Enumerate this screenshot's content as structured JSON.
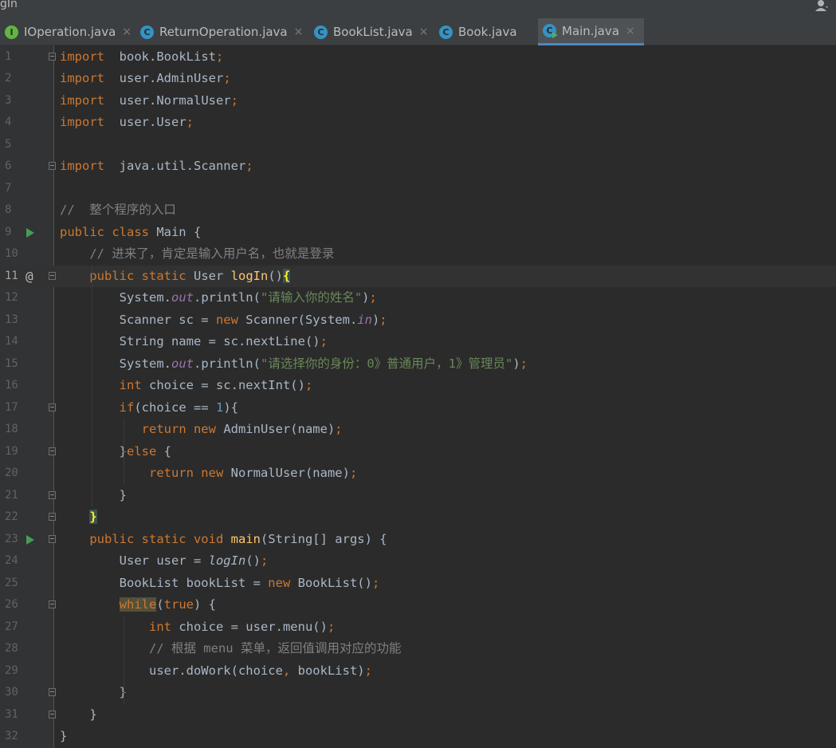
{
  "window": {
    "title": "gIn"
  },
  "tabs": [
    {
      "label": "IOperation.java",
      "icon": "I",
      "icon_type": "iface",
      "close": "×",
      "active": false
    },
    {
      "label": "ReturnOperation.java",
      "icon": "C",
      "icon_type": "cls",
      "close": "×",
      "active": false
    },
    {
      "label": "BookList.java",
      "icon": "C",
      "icon_type": "cls",
      "close": "×",
      "active": false
    },
    {
      "label": "Book.java",
      "icon": "C",
      "icon_type": "cls",
      "close": "",
      "active": false
    },
    {
      "label": "Main.java",
      "icon": "C",
      "icon_type": "main",
      "close": "×",
      "active": true
    }
  ],
  "editor": {
    "current_line": 11,
    "lines": [
      {
        "n": "1",
        "fold": true,
        "tokens": [
          [
            "kw",
            "import"
          ],
          [
            "",
            "  book.BookList"
          ],
          [
            "kw",
            ";"
          ]
        ]
      },
      {
        "n": "2",
        "tokens": [
          [
            "kw",
            "import"
          ],
          [
            "",
            "  user.AdminUser"
          ],
          [
            "kw",
            ";"
          ]
        ]
      },
      {
        "n": "3",
        "tokens": [
          [
            "kw",
            "import"
          ],
          [
            "",
            "  user.NormalUser"
          ],
          [
            "kw",
            ";"
          ]
        ]
      },
      {
        "n": "4",
        "tokens": [
          [
            "kw",
            "import"
          ],
          [
            "",
            "  user.User"
          ],
          [
            "kw",
            ";"
          ]
        ]
      },
      {
        "n": "5",
        "tokens": []
      },
      {
        "n": "6",
        "fold": true,
        "tokens": [
          [
            "kw",
            "import"
          ],
          [
            "",
            "  java.util.Scanner"
          ],
          [
            "kw",
            ";"
          ]
        ]
      },
      {
        "n": "7",
        "tokens": []
      },
      {
        "n": "8",
        "tokens": [
          [
            "cm",
            "//  整个程序的入口"
          ]
        ]
      },
      {
        "n": "9",
        "run": true,
        "tokens": [
          [
            "kw",
            "public class"
          ],
          [
            "",
            " Main {"
          ]
        ]
      },
      {
        "n": "10",
        "tokens": [
          [
            "",
            "    "
          ],
          [
            "cm",
            "// 进来了，肯定是输入用户名，也就是登录"
          ]
        ]
      },
      {
        "n": "11",
        "at": true,
        "fold": true,
        "tokens": [
          [
            "",
            "    "
          ],
          [
            "kw",
            "public static"
          ],
          [
            "",
            " User "
          ],
          [
            "fn",
            "logIn"
          ],
          [
            "",
            "()"
          ],
          [
            "brace-match",
            "{"
          ]
        ]
      },
      {
        "n": "12",
        "tokens": [
          [
            "",
            "        System."
          ],
          [
            "fld",
            "out"
          ],
          [
            "",
            ".println("
          ],
          [
            "str",
            "\"请输入你的姓名\""
          ],
          [
            "",
            ")"
          ],
          [
            "kw",
            ";"
          ]
        ]
      },
      {
        "n": "13",
        "tokens": [
          [
            "",
            "        Scanner sc = "
          ],
          [
            "kw",
            "new"
          ],
          [
            "",
            " Scanner(System."
          ],
          [
            "fld",
            "in"
          ],
          [
            "",
            ")"
          ],
          [
            "kw",
            ";"
          ]
        ]
      },
      {
        "n": "14",
        "tokens": [
          [
            "",
            "        String name = sc.nextLine()"
          ],
          [
            "kw",
            ";"
          ]
        ]
      },
      {
        "n": "15",
        "tokens": [
          [
            "",
            "        System."
          ],
          [
            "fld",
            "out"
          ],
          [
            "",
            ".println("
          ],
          [
            "str",
            "\"请选择你的身份：0》普通用户，1》管理员\""
          ],
          [
            "",
            ")"
          ],
          [
            "kw",
            ";"
          ]
        ]
      },
      {
        "n": "16",
        "tokens": [
          [
            "",
            "        "
          ],
          [
            "kw",
            "int"
          ],
          [
            "",
            " choice = sc.nextInt()"
          ],
          [
            "kw",
            ";"
          ]
        ]
      },
      {
        "n": "17",
        "fold": true,
        "tokens": [
          [
            "",
            "        "
          ],
          [
            "kw",
            "if"
          ],
          [
            "",
            "(choice == "
          ],
          [
            "num",
            "1"
          ],
          [
            "",
            "){"
          ]
        ]
      },
      {
        "n": "18",
        "tokens": [
          [
            "",
            "           "
          ],
          [
            "kw",
            "return new"
          ],
          [
            "",
            " AdminUser(name)"
          ],
          [
            "kw",
            ";"
          ]
        ]
      },
      {
        "n": "19",
        "fold": true,
        "tokens": [
          [
            "",
            "        }"
          ],
          [
            "kw",
            "else"
          ],
          [
            "",
            " {"
          ]
        ]
      },
      {
        "n": "20",
        "tokens": [
          [
            "",
            "            "
          ],
          [
            "kw",
            "return new"
          ],
          [
            "",
            " NormalUser(name)"
          ],
          [
            "kw",
            ";"
          ]
        ]
      },
      {
        "n": "21",
        "fold": true,
        "tokens": [
          [
            "",
            "        }"
          ]
        ]
      },
      {
        "n": "22",
        "fold": true,
        "tokens": [
          [
            "",
            "    "
          ],
          [
            "brace-match",
            "}"
          ]
        ]
      },
      {
        "n": "23",
        "run": true,
        "fold": true,
        "tokens": [
          [
            "",
            "    "
          ],
          [
            "kw",
            "public static void"
          ],
          [
            "",
            " "
          ],
          [
            "fn",
            "main"
          ],
          [
            "",
            "(String[] args) {"
          ]
        ]
      },
      {
        "n": "24",
        "tokens": [
          [
            "",
            "        User user = "
          ],
          [
            "it",
            "logIn"
          ],
          [
            "",
            "()"
          ],
          [
            "kw",
            ";"
          ]
        ]
      },
      {
        "n": "25",
        "tokens": [
          [
            "",
            "        BookList bookList = "
          ],
          [
            "kw",
            "new"
          ],
          [
            "",
            " BookList()"
          ],
          [
            "kw",
            ";"
          ]
        ]
      },
      {
        "n": "26",
        "fold": true,
        "tokens": [
          [
            "",
            "        "
          ],
          [
            "kw while-hl",
            "while"
          ],
          [
            "",
            "("
          ],
          [
            "kw",
            "true"
          ],
          [
            "",
            ") {"
          ]
        ]
      },
      {
        "n": "27",
        "tokens": [
          [
            "",
            "            "
          ],
          [
            "kw",
            "int"
          ],
          [
            "",
            " choice = user.menu()"
          ],
          [
            "kw",
            ";"
          ]
        ]
      },
      {
        "n": "28",
        "tokens": [
          [
            "",
            "            "
          ],
          [
            "cm",
            "// 根据 menu 菜单，返回值调用对应的功能"
          ]
        ]
      },
      {
        "n": "29",
        "tokens": [
          [
            "",
            "            user.doWork(choice"
          ],
          [
            "kw",
            ","
          ],
          [
            "",
            " bookList)"
          ],
          [
            "kw",
            ";"
          ]
        ]
      },
      {
        "n": "30",
        "fold": true,
        "tokens": [
          [
            "",
            "        }"
          ]
        ]
      },
      {
        "n": "31",
        "fold": true,
        "tokens": [
          [
            "",
            "    }"
          ]
        ]
      },
      {
        "n": "32",
        "tokens": [
          [
            "",
            "}"
          ]
        ]
      }
    ]
  },
  "colors": {
    "background": "#2b2b2b",
    "keyword": "#cc7832",
    "string": "#6a8759",
    "number": "#6897bb",
    "comment": "#808080",
    "field": "#9876aa",
    "method": "#ffc66d",
    "accent": "#4a88c7"
  }
}
